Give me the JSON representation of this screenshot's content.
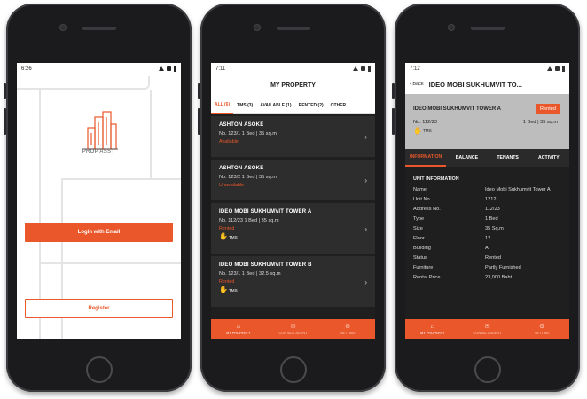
{
  "login_screen": {
    "status_time": "6:26",
    "logo_text": "PROP ASST",
    "login_button": "Login with Email",
    "register_button": "Register"
  },
  "list_screen": {
    "status_time": "7:11",
    "title": "MY PROPERTY",
    "tabs": [
      {
        "label": "ALL (6)",
        "active": true
      },
      {
        "label": "TMS (3)",
        "active": false
      },
      {
        "label": "AVAILABLE (1)",
        "active": false
      },
      {
        "label": "RENTED (2)",
        "active": false
      },
      {
        "label": "OTHER",
        "active": false
      }
    ],
    "properties": [
      {
        "name": "ASHTON ASOKE",
        "info": "No. 123/1   1 Bed | 35 sq.m",
        "status": "Available",
        "tms": ""
      },
      {
        "name": "ASHTON ASOKE",
        "info": "No. 123/2   1 Bed | 35 sq.m",
        "status": "Unavailable",
        "tms": ""
      },
      {
        "name": "IDEO MOBI SUKHUMVIT TOWER A",
        "info": "No. 112/23   1 Bed | 35 sq.m",
        "status": "Rented",
        "tms": "TMS"
      },
      {
        "name": "IDEO MOBI SUKHUMVIT TOWER B",
        "info": "No. 123/1   1 Bed | 32.5 sq.m",
        "status": "Rented",
        "tms": "TMS"
      }
    ],
    "nav": [
      {
        "label": "MY PROPERTY",
        "icon": "home-icon",
        "active": true
      },
      {
        "label": "CONTACT AGENT",
        "icon": "mail-icon",
        "active": false
      },
      {
        "label": "SETTING",
        "icon": "gear-icon",
        "active": false
      }
    ]
  },
  "detail_screen": {
    "status_time": "7:12",
    "back_label": "Back",
    "title": "IDEO MOBI SUKHUMVIT TO...",
    "property_name": "IDEO MOBI SUKHUMVIT TOWER A",
    "status_badge": "Rented",
    "unit": "No. 112/23",
    "summary": "1 Bed | 35 sq.m",
    "tms": "TMS",
    "tabs": [
      {
        "label": "INFORMATION",
        "active": true
      },
      {
        "label": "BALANCE",
        "active": false
      },
      {
        "label": "TENANTS",
        "active": false
      },
      {
        "label": "ACTIVITY",
        "active": false
      }
    ],
    "section_title": "UNIT INFORMATION",
    "fields": [
      {
        "k": "Name",
        "v": "Ideo Mobi Sukhumvit Tower A"
      },
      {
        "k": "Unit No.",
        "v": "1212"
      },
      {
        "k": "Address No.",
        "v": "112/23"
      },
      {
        "k": "Type",
        "v": "1 Bed"
      },
      {
        "k": "Size",
        "v": "35 Sq.m"
      },
      {
        "k": "Floor",
        "v": "12"
      },
      {
        "k": "Building",
        "v": "A"
      },
      {
        "k": "Status",
        "v": "Rented"
      },
      {
        "k": "Furniture",
        "v": "Partly Furnished"
      },
      {
        "k": "Rental Price",
        "v": "23,000 Baht"
      }
    ],
    "nav": [
      {
        "label": "MY PROPERTY",
        "icon": "home-icon",
        "active": true
      },
      {
        "label": "CONTACT AGENT",
        "icon": "mail-icon",
        "active": false
      },
      {
        "label": "SETTING",
        "icon": "gear-icon",
        "active": false
      }
    ]
  },
  "colors": {
    "accent": "#e9572b",
    "dark_bg": "#1f1f1f",
    "card_bg": "#2d2d2d",
    "header_gray": "#bdbdbd"
  }
}
